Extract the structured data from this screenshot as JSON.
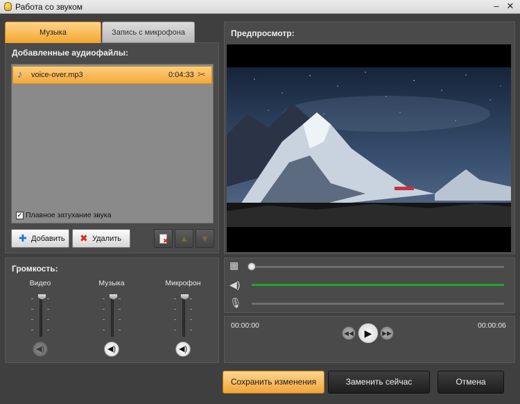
{
  "window": {
    "title": "Работа со звуком",
    "close_symbol": "✕",
    "minimize_symbol": "–"
  },
  "tabs": [
    {
      "label": "Музыка",
      "active": true
    },
    {
      "label": "Запись с микрофона",
      "active": false
    }
  ],
  "audio_files": {
    "heading": "Добавленные аудиофайлы:",
    "items": [
      {
        "name": "voice-over.mp3",
        "duration": "0:04:33"
      }
    ],
    "fade_checkbox_label": "Плавное затухание звука",
    "fade_checked": true
  },
  "buttons": {
    "add_label": "Добавить",
    "delete_label": "Удалить"
  },
  "volume": {
    "heading": "Громкость:",
    "channels": [
      {
        "label": "Видео",
        "level": 1.0,
        "muted": true
      },
      {
        "label": "Музыка",
        "level": 1.0,
        "muted": false
      },
      {
        "label": "Микрофон",
        "level": 1.0,
        "muted": false
      }
    ]
  },
  "preview": {
    "heading": "Предпросмотр:",
    "image_description_icon": "mountain-night-sky-video-frame"
  },
  "player": {
    "time_current": "00:00:00",
    "time_total": "00:00:06",
    "position": 0.0,
    "music_track_active": true
  },
  "footer": {
    "save_label": "Сохранить изменения",
    "replace_label": "Заменить сейчас",
    "cancel_label": "Отмена"
  },
  "colors": {
    "accent": "#f4a52e",
    "music_line": "#22a52a",
    "window_bg": "#3f3f3f"
  }
}
